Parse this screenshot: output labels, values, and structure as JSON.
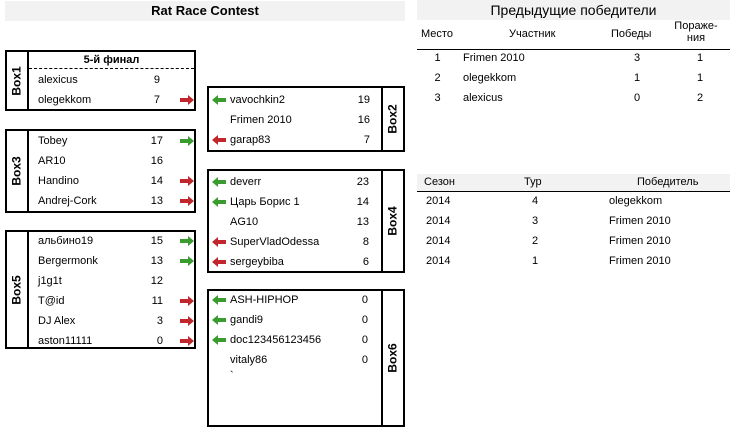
{
  "title": "Rat Race Contest",
  "previous": {
    "title": "Предыдущие победители",
    "headers": {
      "place": "Место",
      "player": "Участник",
      "wins": "Победы",
      "losses_1": "Пораже-",
      "losses_2": "ния"
    },
    "rows": [
      {
        "place": "1",
        "player": "Frimen 2010",
        "wins": "3",
        "losses": "1"
      },
      {
        "place": "2",
        "player": "olegekkom",
        "wins": "1",
        "losses": "1"
      },
      {
        "place": "3",
        "player": "alexicus",
        "wins": "0",
        "losses": "2"
      }
    ]
  },
  "seasons": {
    "headers": {
      "season": "Сезон",
      "round": "Тур",
      "winner": "Победитель"
    },
    "rows": [
      {
        "season": "2014",
        "round": "4",
        "winner": "olegekkom"
      },
      {
        "season": "2014",
        "round": "3",
        "winner": "Frimen 2010"
      },
      {
        "season": "2014",
        "round": "2",
        "winner": "Frimen 2010"
      },
      {
        "season": "2014",
        "round": "1",
        "winner": "Frimen 2010"
      }
    ]
  },
  "box1": {
    "label": "Box1",
    "final_label": "5-й финал",
    "players": [
      {
        "name": "alexicus",
        "score": "9",
        "arrow": "none"
      },
      {
        "name": "olegekkom",
        "score": "7",
        "arrow": "red-right-arrow"
      }
    ]
  },
  "box2": {
    "label": "Box2",
    "players": [
      {
        "name": "vavochkin2",
        "score": "19",
        "arrow": "green-left-arrow"
      },
      {
        "name": "Frimen 2010",
        "score": "16",
        "arrow": "none"
      },
      {
        "name": "garap83",
        "score": "7",
        "arrow": "red-left-arrow"
      }
    ]
  },
  "box3": {
    "label": "Box3",
    "players": [
      {
        "name": "Tobey",
        "score": "17",
        "arrow": "green-right-arrow"
      },
      {
        "name": "AR10",
        "score": "16",
        "arrow": "none"
      },
      {
        "name": "Handino",
        "score": "14",
        "arrow": "red-right-arrow"
      },
      {
        "name": "Andrej-Cork",
        "score": "13",
        "arrow": "red-right-arrow"
      }
    ]
  },
  "box4": {
    "label": "Box4",
    "players": [
      {
        "name": "deverr",
        "score": "23",
        "arrow": "green-left-arrow"
      },
      {
        "name": "Царь Борис 1",
        "score": "14",
        "arrow": "green-left-arrow"
      },
      {
        "name": "AG10",
        "score": "13",
        "arrow": "none"
      },
      {
        "name": "SuperVladOdessa",
        "score": "8",
        "arrow": "red-left-arrow"
      },
      {
        "name": "sergeybiba",
        "score": "6",
        "arrow": "red-left-arrow"
      }
    ]
  },
  "box5": {
    "label": "Box5",
    "players": [
      {
        "name": "альбино19",
        "score": "15",
        "arrow": "green-right-arrow"
      },
      {
        "name": "Bergermonk",
        "score": "13",
        "arrow": "green-right-arrow"
      },
      {
        "name": "j1g1t",
        "score": "12",
        "arrow": "none"
      },
      {
        "name": "T@id",
        "score": "11",
        "arrow": "red-right-arrow"
      },
      {
        "name": "DJ Alex",
        "score": "3",
        "arrow": "red-right-arrow"
      },
      {
        "name": "aston11111",
        "score": "0",
        "arrow": "red-right-arrow"
      }
    ]
  },
  "box6": {
    "label": "Box6",
    "players": [
      {
        "name": "ASH-HIPHOP",
        "score": "0",
        "arrow": "green-left-arrow"
      },
      {
        "name": "gandi9",
        "score": "0",
        "arrow": "green-left-arrow"
      },
      {
        "name": "doc123456123456",
        "score": "0",
        "arrow": "green-left-arrow"
      },
      {
        "name": "vitaly86",
        "score": "0",
        "arrow": "none"
      }
    ],
    "extra": "`"
  },
  "colors": {
    "green": "#3a9b2e",
    "red": "#c0262b",
    "header_bg": "#f2f2f2"
  }
}
